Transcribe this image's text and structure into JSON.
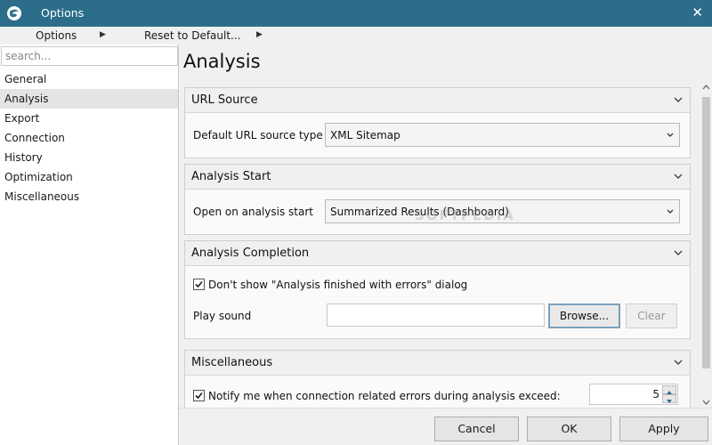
{
  "window": {
    "title": "Options",
    "close_icon": "close-icon",
    "accent": "#2c6e8a"
  },
  "menubar": {
    "options_label": "Options",
    "reset_label": "Reset to Default..."
  },
  "sidebar": {
    "search_placeholder": "search...",
    "items": [
      {
        "label": "General"
      },
      {
        "label": "Analysis",
        "selected": true
      },
      {
        "label": "Export"
      },
      {
        "label": "Connection"
      },
      {
        "label": "History"
      },
      {
        "label": "Optimization"
      },
      {
        "label": "Miscellaneous"
      }
    ]
  },
  "page": {
    "title": "Analysis"
  },
  "groups": {
    "url_source": {
      "title": "URL Source",
      "label": "Default URL source type",
      "value": "XML Sitemap"
    },
    "analysis_start": {
      "title": "Analysis Start",
      "label": "Open on analysis start",
      "value": "Summarized Results (Dashboard)"
    },
    "analysis_completion": {
      "title": "Analysis Completion",
      "checkbox_label": "Don't show \"Analysis finished with errors\" dialog",
      "checkbox_checked": true,
      "play_sound_label": "Play sound",
      "play_sound_value": "",
      "browse_label": "Browse...",
      "clear_label": "Clear"
    },
    "miscellaneous": {
      "title": "Miscellaneous",
      "checkbox_label": "Notify me when connection related errors during analysis exceed:",
      "checkbox_checked": true,
      "threshold": "5"
    }
  },
  "buttons": {
    "cancel": "Cancel",
    "ok": "OK",
    "apply": "Apply"
  },
  "watermark": "SOFTPEDIA"
}
